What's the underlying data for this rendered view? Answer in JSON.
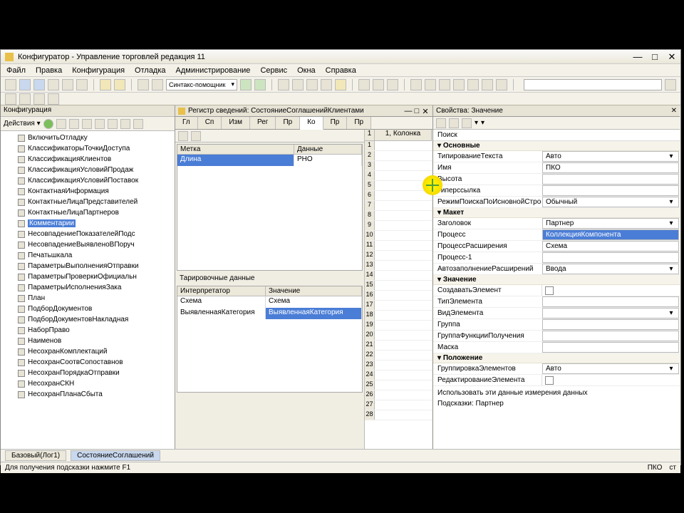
{
  "window": {
    "title": "Конфигуратор - Управление торговлей редакция 11",
    "min": "—",
    "max": "□",
    "close": "✕"
  },
  "menu": [
    "Файл",
    "Правка",
    "Конфигурация",
    "Отладка",
    "Администрирование",
    "Сервис",
    "Окна",
    "Справка"
  ],
  "toolbar_combo": "Синтакс-помощник",
  "left": {
    "header": "Конфигурация",
    "items": [
      "ВключитьОтладку",
      "КлассификаторыТочкиДоступа",
      "КлассификацияКлиентов",
      "КлассификацияУсловийПродаж",
      "КлассификацияУсловийПоставок",
      "КонтактнаяИнформация",
      "КонтактныеЛицаПредставителей",
      "КонтактныеЛицаПартнеров",
      "Комментарии",
      "НесовпадениеПоказателейПодс",
      "НесовпадениеВыявленоВПоруч",
      "Печатьшкала",
      "ПараметрыВыполненияОтправки",
      "ПараметрыПроверкиОфициальн",
      "ПараметрыИсполненияЗака",
      "План",
      "ПодборДокументов",
      "ПодборДокументовНакладная",
      "НаборПраво",
      "Наименов",
      "НесохранКомплектаций",
      "НесохранСоотвСопоставнов",
      "НесохранПорядкаОтправки",
      "НесохранСКН",
      "НесохранПланаСбыта"
    ],
    "selected_index": 8
  },
  "center": {
    "title": "Регистр сведений: СостояниеСоглашенийКлиентами",
    "tabs": [
      "Гл",
      "Сп",
      "Изм",
      "Рег",
      "Пр",
      "Ко",
      "Пр",
      "Пр"
    ],
    "active_tab": 5,
    "tb2_btns": 2,
    "grid1": {
      "cols": [
        "Метка",
        "Данные"
      ],
      "row_sel": [
        "Длина",
        "РНО"
      ]
    },
    "grid2_title": "Тарировочные данные",
    "grid2": {
      "cols": [
        "Интерпретатор",
        "Значение"
      ],
      "rows": [
        [
          "Схема",
          "Схема"
        ],
        [
          "ВыявленнаяКатегория",
          "ВыявленнаяКатегория"
        ]
      ],
      "row_sel_index": 1
    },
    "ruler_header": "1, Колонка"
  },
  "right": {
    "header": "Свойства: Значение",
    "prop_title": "Поиск",
    "sections": {
      "s1": "Основные",
      "s2": "Макет",
      "s3": "Значение",
      "s4": "Положение"
    },
    "rows": [
      {
        "label": "ТипированиеТекста",
        "val": "Авто",
        "dd": true
      },
      {
        "label": "Имя",
        "val": "ПКО"
      },
      {
        "label": "Высота",
        "val": ""
      },
      {
        "label": "Гиперссылка",
        "val": ""
      },
      {
        "label": "РежимПоискаПоИсновнойСтроке",
        "val": "Обычный",
        "dd": true
      }
    ],
    "rows2": [
      {
        "label": "Заголовок",
        "val": "Партнер",
        "dd": true
      },
      {
        "label": "Процесс",
        "val": "КоллекцияКомпонента",
        "sel": true
      },
      {
        "label": "ПроцессРасширения",
        "val": "Схема"
      },
      {
        "label": "Процесс-1",
        "val": ""
      },
      {
        "label": "АвтозаполнениеРасширений",
        "val": "Ввода",
        "dd": true
      }
    ],
    "rows3": [
      {
        "label": "СоздаватьЭлемент",
        "check": true
      },
      {
        "label": "ТипЭлемента",
        "val": ""
      },
      {
        "label": "ВидЭлемента",
        "val": "",
        "dd": true
      },
      {
        "label": "Группа",
        "val": ""
      },
      {
        "label": "ГруппаФункцииПолучения",
        "val": ""
      },
      {
        "label": "Маска",
        "val": ""
      }
    ],
    "rows4": [
      {
        "label": "ГруппировкаЭлементов",
        "val": "Авто",
        "dd": true
      },
      {
        "label": "РедактированиеЭлемента",
        "check": true
      }
    ],
    "footer_note1": "Использовать эти данные измерения данных",
    "footer_note2": "Подсказки: Партнер"
  },
  "footer": {
    "tabs": [
      "Базовый(Лог1)",
      "СостояниеСоглашений"
    ],
    "active": 1
  },
  "status": {
    "left": "Для получения подсказки нажмите F1",
    "r1": "ПКО",
    "r2": "ст"
  }
}
